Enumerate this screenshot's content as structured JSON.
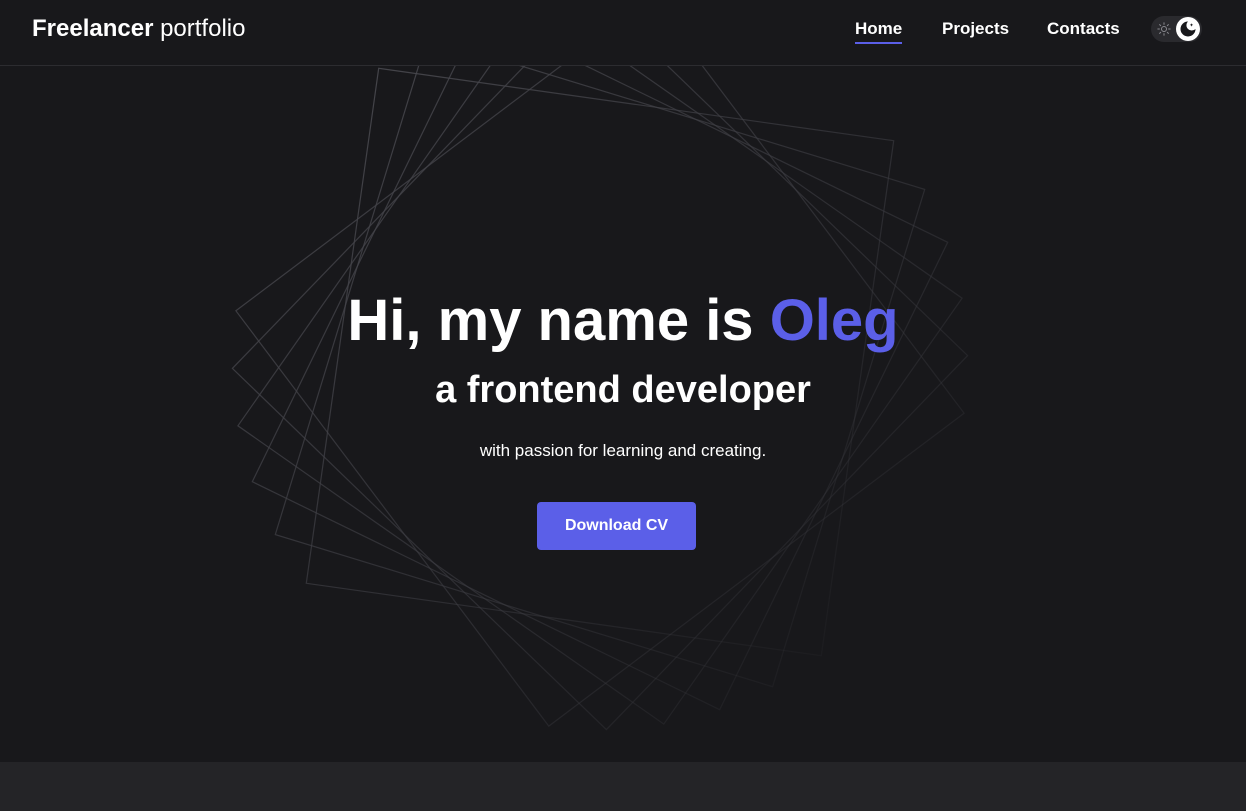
{
  "header": {
    "logo_bold": "Freelancer",
    "logo_light": " portfolio",
    "nav": [
      {
        "label": "Home",
        "active": true
      },
      {
        "label": "Projects",
        "active": false
      },
      {
        "label": "Contacts",
        "active": false
      }
    ],
    "theme_toggle": {
      "state": "dark",
      "icons": [
        "sun-icon",
        "moon-icon"
      ]
    }
  },
  "hero": {
    "headline_prefix": "Hi, my name is ",
    "headline_name": "Oleg",
    "role": "a frontend developer",
    "tagline": "with passion for learning and creating.",
    "cta_label": "Download CV"
  },
  "colors": {
    "background": "#18181b",
    "accent": "#5b5fe8",
    "text": "#ffffff",
    "next_section": "#242427"
  }
}
